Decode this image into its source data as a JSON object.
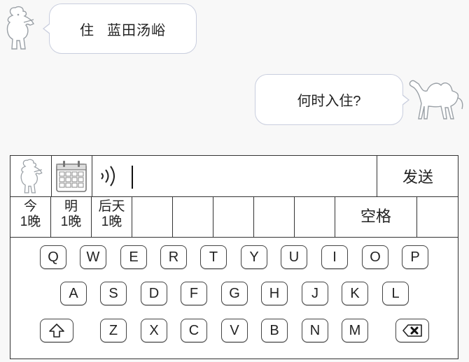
{
  "chat": {
    "message_left_word1": "住",
    "message_left_word2": "蓝田汤峪",
    "message_right": "何时入住?"
  },
  "input_bar": {
    "send_label": "发送"
  },
  "candidates": [
    {
      "line1": "今",
      "line2": "1晚"
    },
    {
      "line1": "明",
      "line2": "1晚"
    },
    {
      "line1": "后天",
      "line2": "1晚"
    },
    {
      "line1": "",
      "line2": ""
    },
    {
      "line1": "",
      "line2": ""
    },
    {
      "line1": "",
      "line2": ""
    },
    {
      "line1": "",
      "line2": ""
    }
  ],
  "space_label": "空格",
  "keyboard": {
    "row1": [
      "Q",
      "W",
      "E",
      "R",
      "T",
      "Y",
      "U",
      "I",
      "O",
      "P"
    ],
    "row2": [
      "A",
      "S",
      "D",
      "F",
      "G",
      "H",
      "J",
      "K",
      "L"
    ],
    "row3": [
      "Z",
      "X",
      "C",
      "V",
      "B",
      "N",
      "M"
    ]
  },
  "icons": {
    "bot": "bot-avatar-icon",
    "camel": "camel-avatar-icon",
    "calendar": "calendar-icon",
    "voice": "voice-icon",
    "shift": "shift-arrow-icon",
    "backspace": "backspace-icon"
  }
}
